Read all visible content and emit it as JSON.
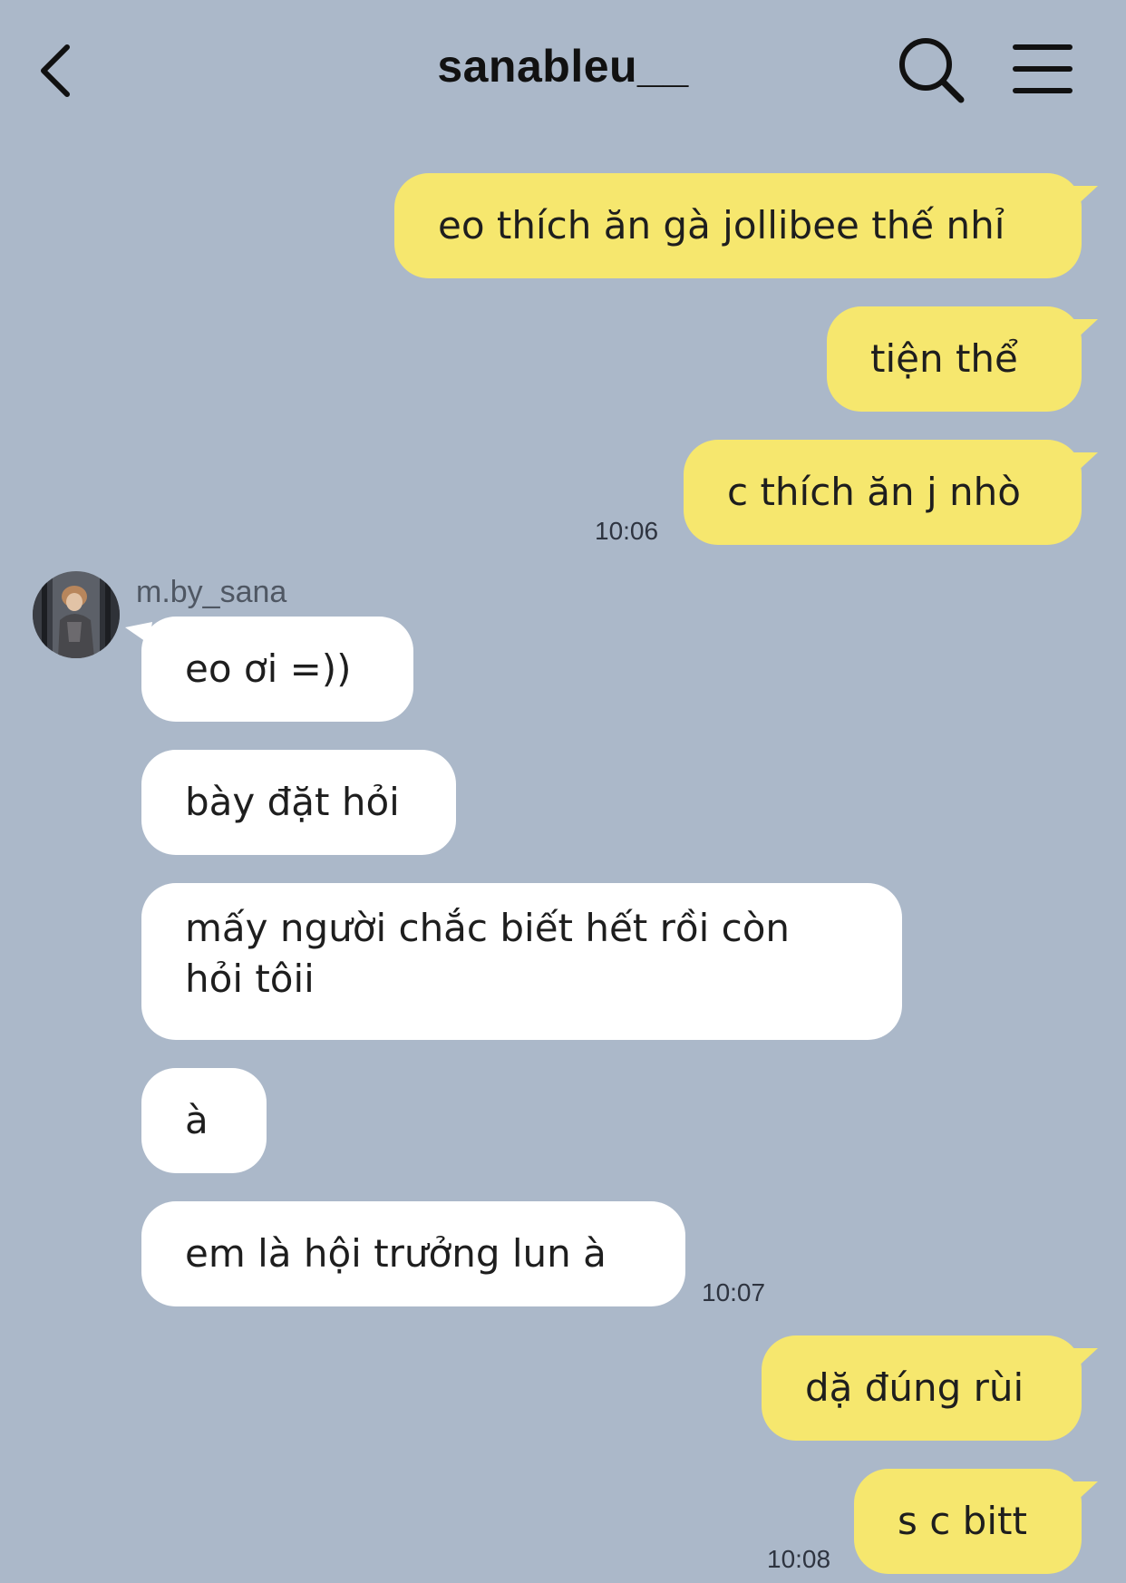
{
  "header": {
    "title": "sanableu__",
    "back_icon": "chevron-left-icon",
    "search_icon": "search-icon",
    "menu_icon": "hamburger-menu-icon"
  },
  "colors": {
    "background": "#abb8c9",
    "my_bubble": "#f6e76e",
    "their_bubble": "#ffffff"
  },
  "conversation": {
    "sender_name": "m.by_sana",
    "messages_group1": [
      "eo thích ăn gà jollibee thế nhỉ",
      "tiện thể",
      "c thích ăn j nhò"
    ],
    "time1": "10:06",
    "messages_group2": [
      "eo ơi =))",
      "bày đặt hỏi",
      "mấy người chắc biết hết rồi còn hỏi tôii",
      "à",
      "em là hội trưởng lun à"
    ],
    "time2": "10:07",
    "messages_group3": [
      "dặ đúng rùi",
      "s c bitt"
    ],
    "time3": "10:08"
  }
}
